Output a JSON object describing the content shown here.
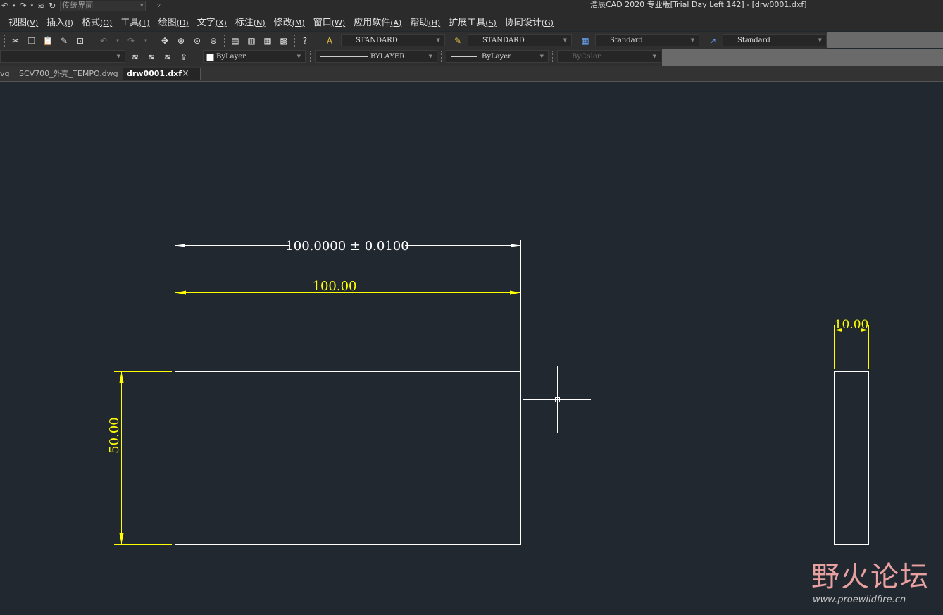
{
  "window": {
    "title": "浩辰CAD 2020 专业版[Trial Day Left 142] - [drw0001.dxf]",
    "workspace": "传统界面"
  },
  "menubar": [
    {
      "label": "视图",
      "key": "(V)"
    },
    {
      "label": "插入",
      "key": "(I)"
    },
    {
      "label": "格式",
      "key": "(O)"
    },
    {
      "label": "工具",
      "key": "(T)"
    },
    {
      "label": "绘图",
      "key": "(D)"
    },
    {
      "label": "文字",
      "key": "(X)"
    },
    {
      "label": "标注",
      "key": "(N)"
    },
    {
      "label": "修改",
      "key": "(M)"
    },
    {
      "label": "窗口",
      "key": "(W)"
    },
    {
      "label": "应用软件",
      "key": "(A)"
    },
    {
      "label": "帮助",
      "key": "(H)"
    },
    {
      "label": "扩展工具",
      "key": "(S)"
    },
    {
      "label": "协同设计",
      "key": "(G)"
    }
  ],
  "styles_toolbar": {
    "text_style": "STANDARD",
    "dim_style": "STANDARD",
    "table_style": "Standard",
    "multileader_style": "Standard"
  },
  "properties_toolbar": {
    "color": "ByLayer",
    "linetype": "BYLAYER",
    "lineweight": "ByLayer",
    "plot_style": "ByColor"
  },
  "tabs": [
    {
      "label": "vg"
    },
    {
      "label": "SCV700_外壳_TEMPO.dwg"
    },
    {
      "label": "drw0001.dxf",
      "active": true
    }
  ],
  "drawing": {
    "dim_tolerance_text": "100.0000 ± 0.0100",
    "dim_width_text": "100.00",
    "dim_height_text": "50.00",
    "dim_thickness_text": "10.00",
    "colors": {
      "background": "#212830",
      "geometry": "#ffffff",
      "dimension": "#ffff00"
    }
  },
  "watermark": {
    "name": "野火论坛",
    "url": "www.proewildfire.cn"
  }
}
